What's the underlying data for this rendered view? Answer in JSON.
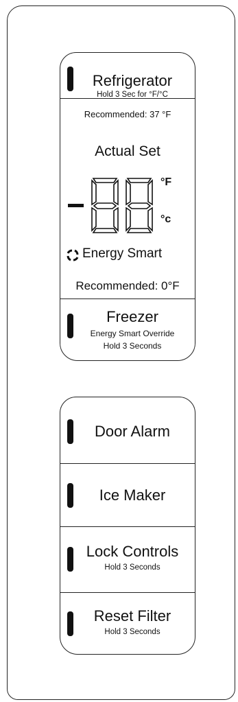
{
  "refrigerator": {
    "label": "Refrigerator",
    "sub": "Hold 3 Sec for °F/°C",
    "recommended": "Recommended: 37 °F"
  },
  "display": {
    "title": "Actual Set",
    "minus": "-",
    "digits": "88",
    "unit_f": "°F",
    "unit_c": "°c",
    "energy_smart": "Energy Smart"
  },
  "freezer": {
    "recommended": "Recommended: 0°F",
    "label": "Freezer",
    "sub1": "Energy Smart Override",
    "sub2": "Hold 3 Seconds"
  },
  "buttons": [
    {
      "label": "Door Alarm",
      "sub": ""
    },
    {
      "label": "Ice Maker",
      "sub": ""
    },
    {
      "label": "Lock Controls",
      "sub": "Hold 3 Seconds"
    },
    {
      "label": "Reset Filter",
      "sub": "Hold 3 Seconds"
    }
  ],
  "colors": {
    "line": "#222222",
    "led": "#111111",
    "background": "#ffffff"
  }
}
